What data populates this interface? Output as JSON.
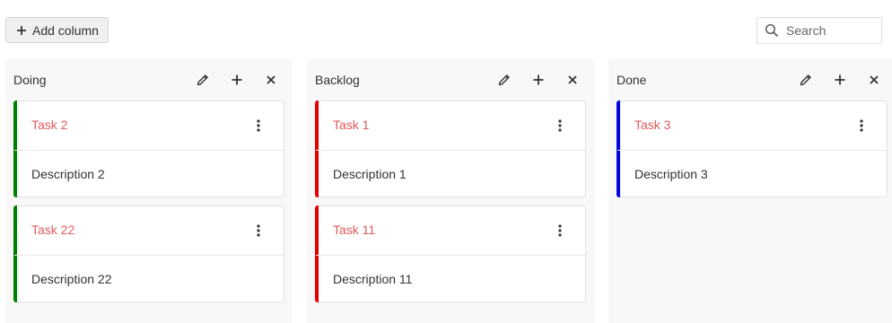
{
  "toolbar": {
    "add_column_label": "Add column",
    "search_placeholder": "Search",
    "search_value": ""
  },
  "colors": {
    "title": "#e0595b",
    "doing_accent": "#008000",
    "backlog_accent": "#e20000",
    "done_accent": "#0000e0"
  },
  "icons": {
    "add_column": "plus-icon",
    "search": "search-icon",
    "edit": "pencil-icon",
    "add_card": "plus-icon",
    "delete": "close-icon",
    "card_menu": "kebab-menu-icon"
  },
  "columns": [
    {
      "title": "Doing",
      "cards": [
        {
          "title": "Task 2",
          "description": "Description 2"
        },
        {
          "title": "Task 22",
          "description": "Description 22"
        }
      ]
    },
    {
      "title": "Backlog",
      "cards": [
        {
          "title": "Task 1",
          "description": "Description 1"
        },
        {
          "title": "Task 11",
          "description": "Description 11"
        }
      ]
    },
    {
      "title": "Done",
      "cards": [
        {
          "title": "Task 3",
          "description": "Description 3"
        }
      ]
    }
  ]
}
